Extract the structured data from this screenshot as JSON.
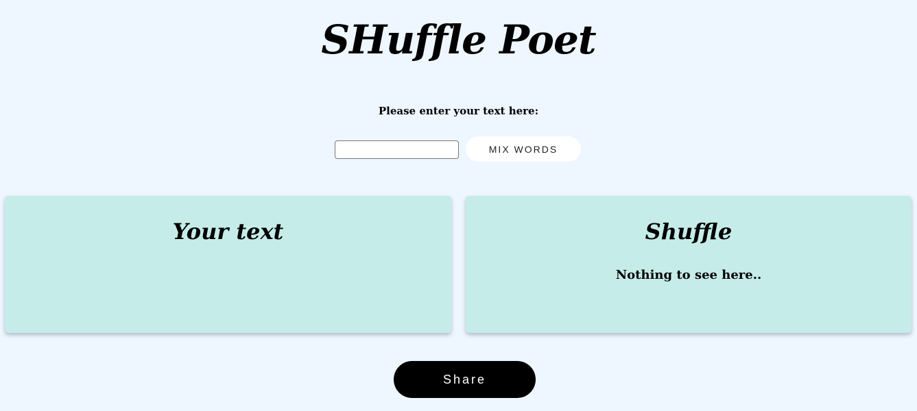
{
  "header": {
    "title": "SHuffle Poet"
  },
  "form": {
    "prompt": "Please enter your text here:",
    "input_value": "",
    "input_placeholder": "",
    "mix_button_label": "MIX WORDS"
  },
  "panels": {
    "your_text": {
      "title": "Your text",
      "content": ""
    },
    "shuffle": {
      "title": "Shuffle",
      "content": "Nothing to see here.."
    }
  },
  "footer": {
    "share_button_label": "Share"
  },
  "colors": {
    "background": "#eef6ff",
    "panel": "#c5ece9",
    "share_button": "#000000",
    "mix_button": "#ffffff"
  }
}
